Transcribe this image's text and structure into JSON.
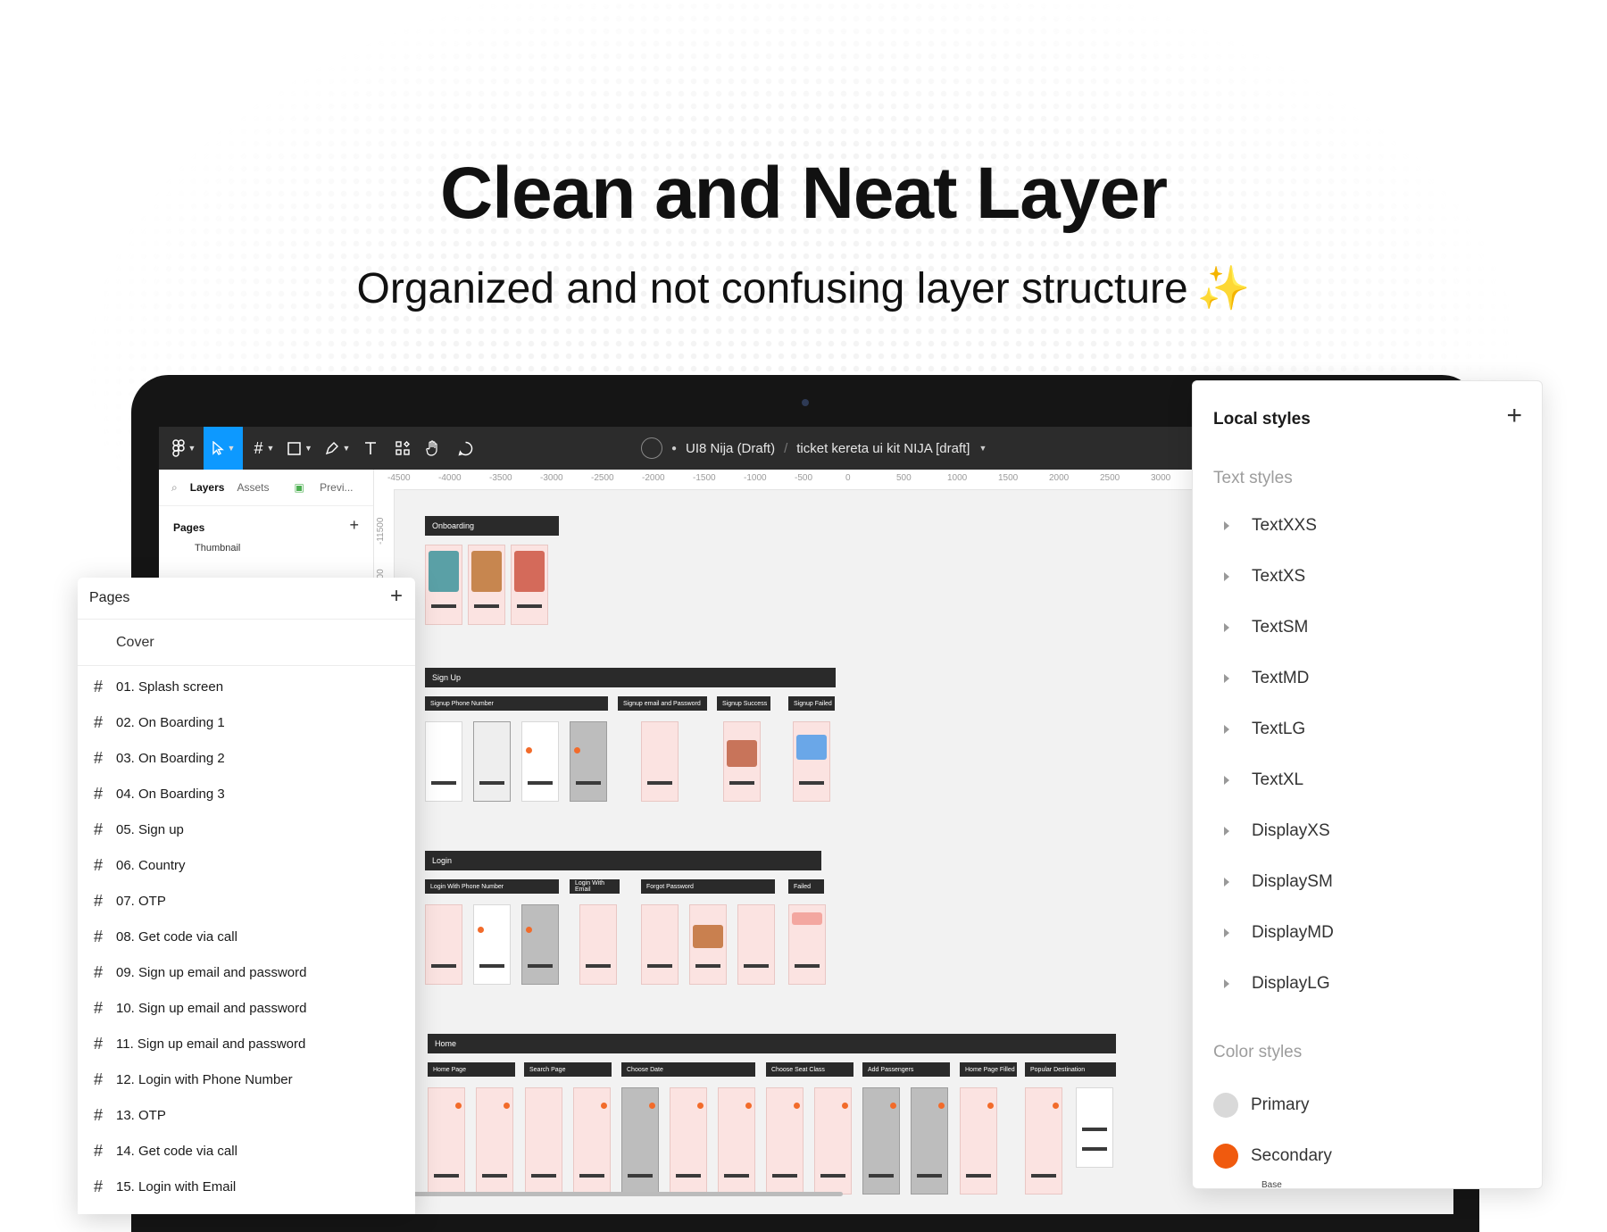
{
  "hero": {
    "title": "Clean and Neat Layer",
    "subtitle": "Organized and not confusing layer structure",
    "sparkle": "✨"
  },
  "toolbar": {
    "file_team": "UI8 Nija (Draft)",
    "file_separator": "/",
    "file_name": "ticket kereta ui kit NIJA [draft]"
  },
  "left_strip": {
    "tabs": [
      "Layers",
      "Assets",
      "Previ..."
    ],
    "pages_label": "Pages",
    "first_item": "Thumbnail"
  },
  "ruler": {
    "top": [
      "-4500",
      "-4000",
      "-3500",
      "-3000",
      "-2500",
      "-2000",
      "-1500",
      "-1000",
      "-500",
      "0",
      "500",
      "1000",
      "1500",
      "2000",
      "2500",
      "3000"
    ],
    "left": [
      "-11500",
      "000"
    ]
  },
  "canvas": {
    "sections": [
      {
        "label": "Onboarding",
        "subs": []
      },
      {
        "label": "Sign Up",
        "subs": [
          "Signup Phone Number",
          "Signup email and Password",
          "Signup Success",
          "Signup Failed"
        ]
      },
      {
        "label": "Login",
        "subs": [
          "Login With Phone Number",
          "Login With Email",
          "Forgot Password",
          "Failed"
        ]
      },
      {
        "label": "Home",
        "subs": [
          "Home Page",
          "Search Page",
          "Choose Date",
          "Choose Seat Class",
          "Add Passengers",
          "Home Page Filled",
          "Popular Destination"
        ]
      }
    ]
  },
  "pages_panel": {
    "title": "Pages",
    "cover": "Cover",
    "pages": [
      "01. Splash screen",
      "02. On Boarding 1",
      "03. On Boarding 2",
      "04. On Boarding 3",
      "05. Sign up",
      "06. Country",
      "07. OTP",
      "08. Get code via call",
      "09. Sign up email and password",
      "10. Sign up email and password",
      "11. Sign up email and password",
      "12. Login  with Phone Number",
      "13. OTP",
      "14. Get code via call",
      "15. Login  with Email"
    ]
  },
  "styles_panel": {
    "title": "Local styles",
    "text_styles_label": "Text styles",
    "text_styles": [
      "TextXXS",
      "TextXS",
      "TextSM",
      "TextMD",
      "TextLG",
      "TextXL",
      "DisplayXS",
      "DisplaySM",
      "DisplayMD",
      "DisplayLG"
    ],
    "color_styles_label": "Color styles",
    "color_styles": [
      {
        "name": "Primary",
        "color": "#d9d9d9"
      },
      {
        "name": "Secondary",
        "color": "#f05a0e"
      }
    ],
    "tail": "Base"
  },
  "colors": {
    "accent": "#0d99ff",
    "toolbar": "#2c2c2c",
    "secondary": "#f05a0e"
  }
}
